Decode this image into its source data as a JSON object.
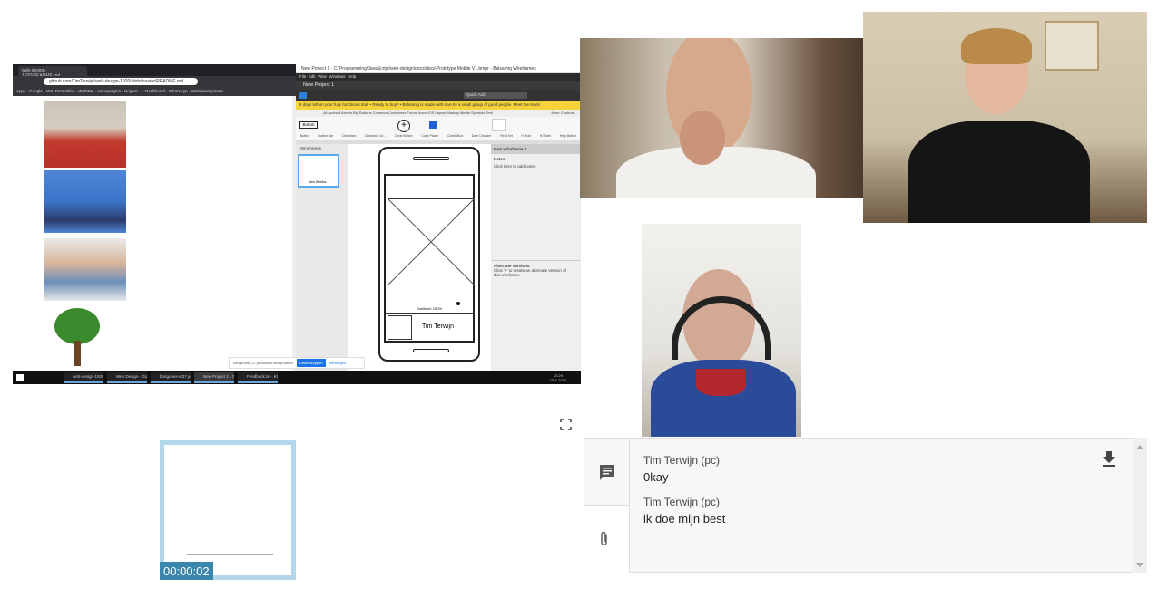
{
  "shared_screen": {
    "browser": {
      "tab_title": "web-design-1920/README.md",
      "address": "github.com/TimTerwijn/web-design-1920/blob/master/README.md",
      "bookmarks": [
        "Apps",
        "Google",
        "NHL Emmablad",
        "WebWet",
        "Homepagina - Hogesc...",
        "Dashboard",
        "WhatsApp",
        "Webdevelopment"
      ]
    },
    "balsamiq": {
      "window_title": "New Project 1 - C:\\Programming\\JavaScript\\web-design\\docs\\docs\\Prototype Mobile V1.bmpr - Balsamiq Wireframes",
      "menu": [
        "File",
        "Edit",
        "View",
        "Windows",
        "Help"
      ],
      "project_name": "New Project 1",
      "quick_add_placeholder": "Quick Add",
      "trial_banner": "8 days left on your fully functional trial. • Ready to buy? • Balsamiq is made with love by a small group of good people. Meet the team!",
      "categories": "All  Android  Assets  Big  Buttons  Common  Containers  Forms  Icons  iOS  Layout  Markup  Media  Symbols  Text",
      "more_controls": "More Controls...",
      "library": [
        "Button",
        "Button Bar",
        "Checkbox",
        "Checkbox Gr...",
        "Circle Button",
        "Color Picker",
        "ComboBox",
        "Date Chooser",
        "Field Set",
        "H.Rule",
        "H.Slider",
        "Help Button"
      ],
      "button_sample": "Button",
      "wireframes_label": "Wireframes",
      "thumb_label": "New Wirefra...",
      "slider_label": "Snelheid: 100%",
      "card_name": "Tim Terwijn",
      "panel_title": "New Wireframe 2",
      "notes_title": "Notes",
      "notes_hint": "Click here to add notes.",
      "alt_title": "Alternate Versions",
      "alt_hint": "Click '+' to create an alternate version of this wireframe."
    },
    "share_bar": {
      "text": "conga-sws-27.youcanco.dedijn.delen",
      "stop_label": "Delen stoppen",
      "hide_label": "Verbergen"
    },
    "taskbar": {
      "items": [
        "web-design-1920/R...",
        "Web Design - Goo...",
        "bongo-ws-rc27.yo...",
        "New Project 1 - C:\\...",
        "Feedback.txt - Klad..."
      ],
      "time": "12:29",
      "date": "15-4-2020"
    }
  },
  "recording": {
    "timer": "00:00:02"
  },
  "chat": {
    "messages": [
      {
        "sender": "Tim Terwijn (pc)",
        "text": "0kay"
      },
      {
        "sender": "Tim Terwijn (pc)",
        "text": "ik doe mijn best"
      }
    ]
  },
  "colors": {
    "accent": "#3b86ad",
    "thumb_border": "#b3d7ea",
    "trial_banner": "#f6d23b"
  }
}
